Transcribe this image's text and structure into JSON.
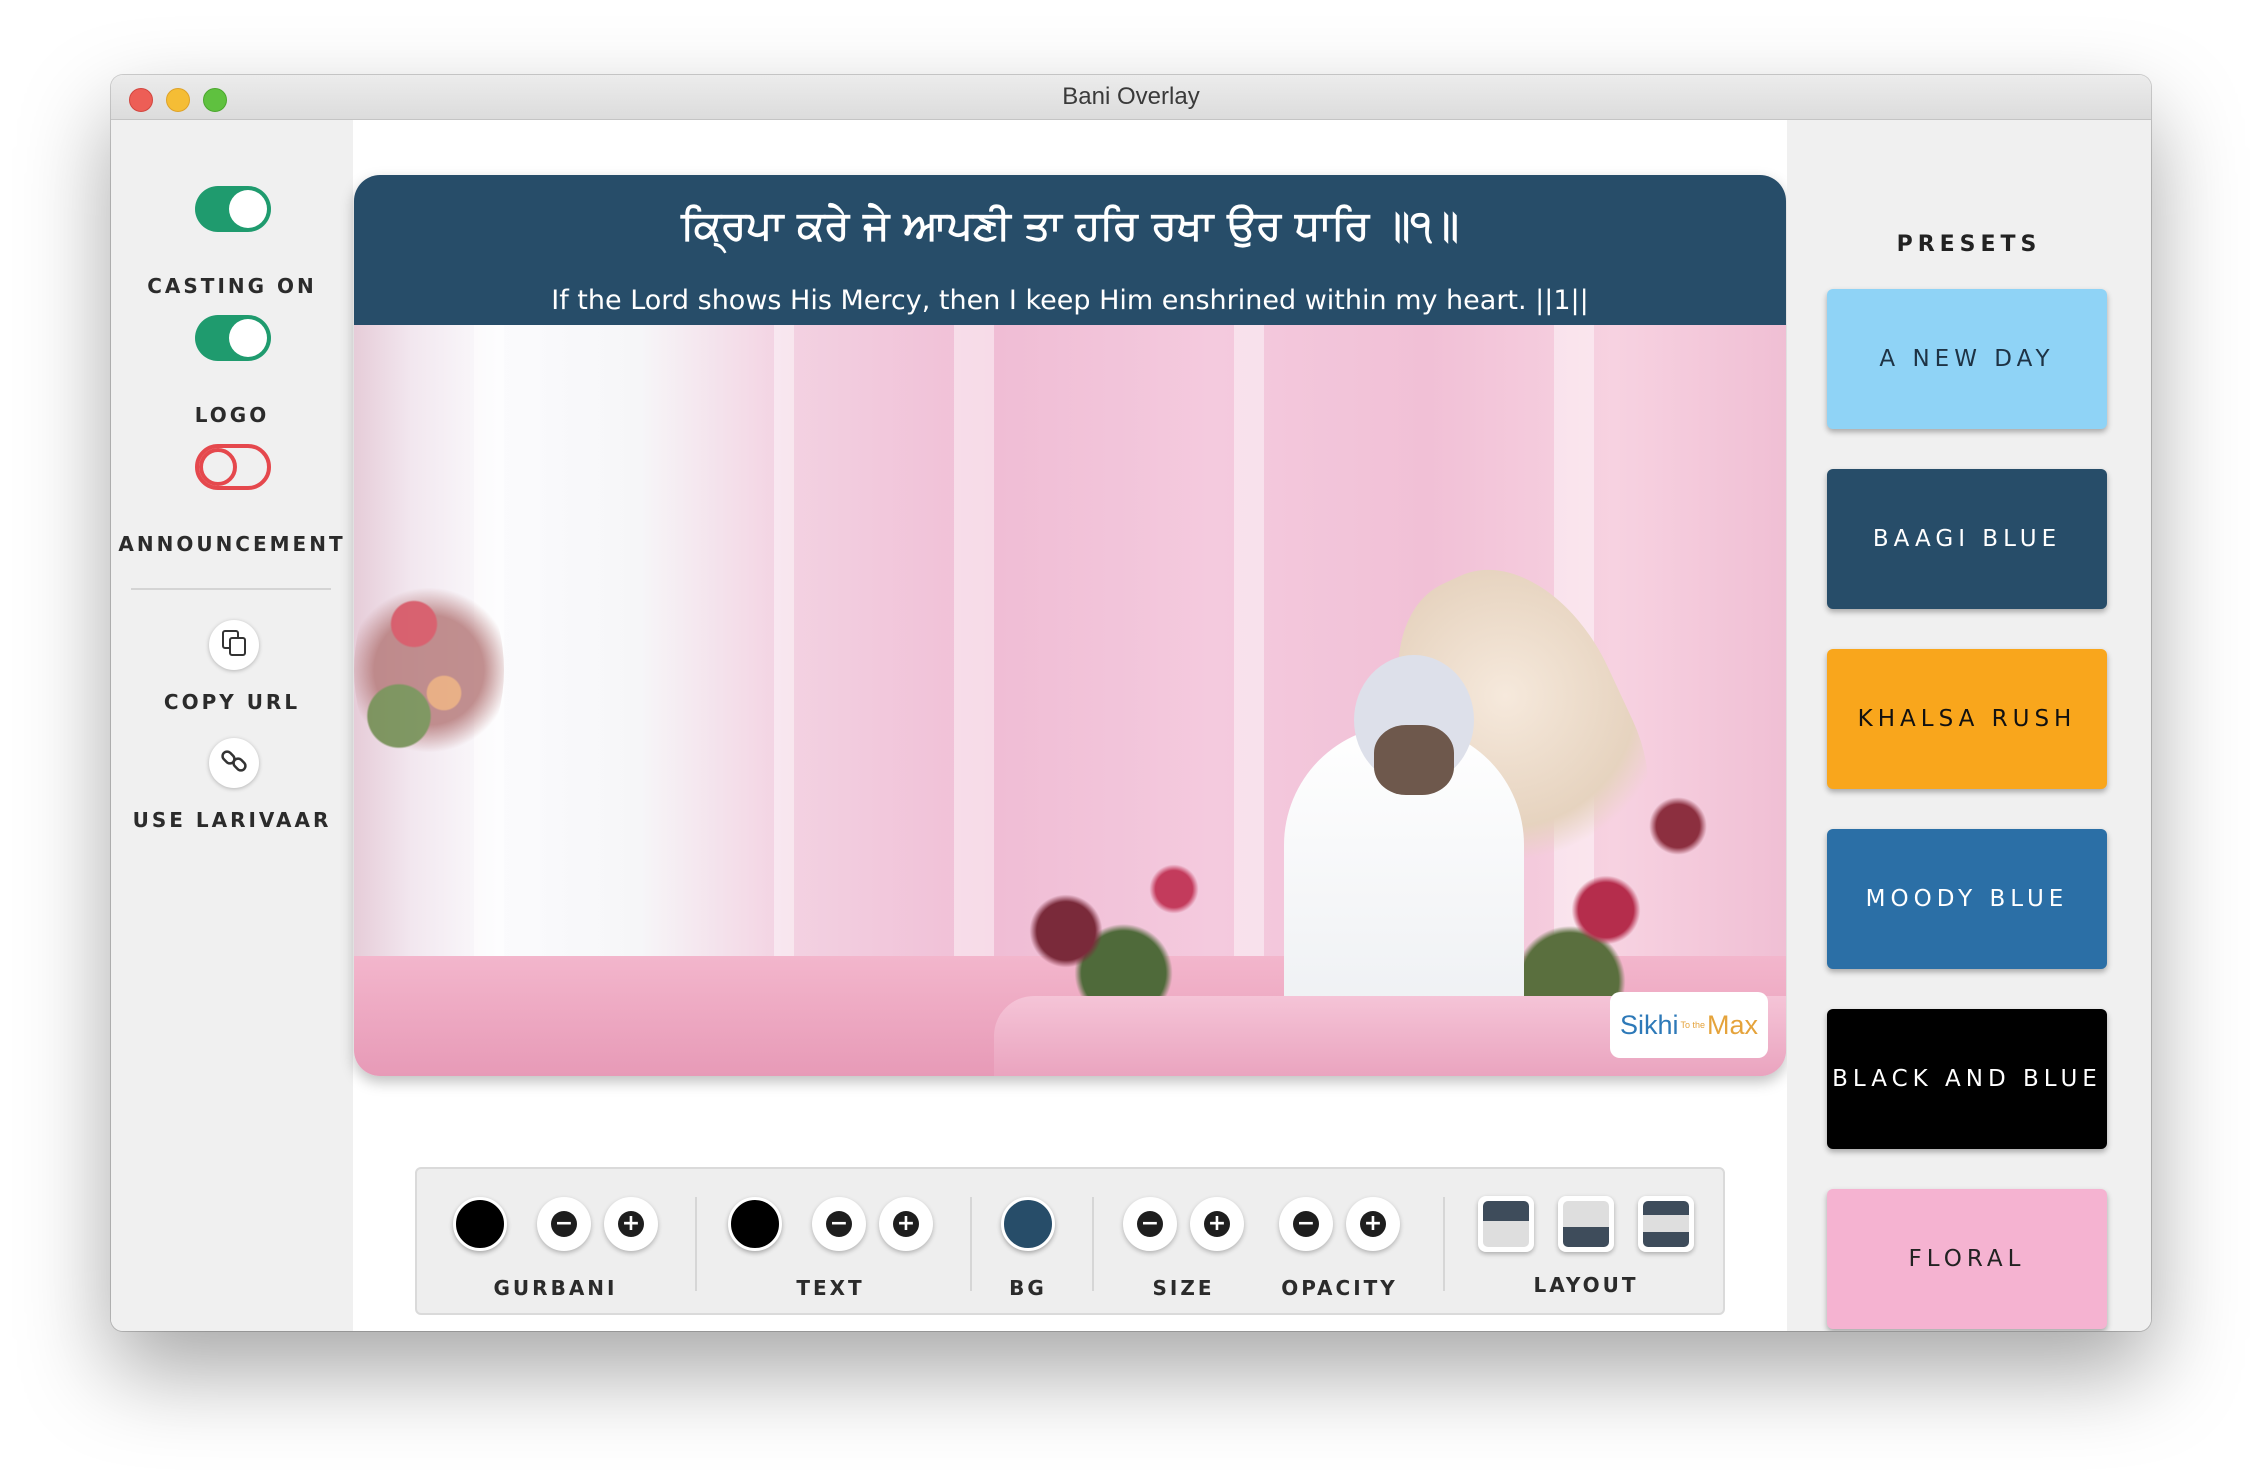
{
  "window": {
    "title": "Bani Overlay"
  },
  "left_panel": {
    "casting": {
      "label": "CASTING ON",
      "state": "on"
    },
    "logo": {
      "label": "LOGO",
      "state": "on"
    },
    "announcement": {
      "label": "ANNOUNCEMENT",
      "state": "off"
    },
    "copy_url": {
      "label": "COPY URL",
      "icon": "copy-icon"
    },
    "larivaar": {
      "label": "USE LARIVAAR",
      "icon": "link-icon"
    }
  },
  "preview": {
    "gurbani": "ਕ੍ਰਿਪਾ ਕਰੇ ਜੇ ਆਪਣੀ ਤਾ ਹਰਿ ਰਖਾ ਉਰ ਧਾਰਿ ॥੧॥",
    "translation": "If the Lord shows His Mercy, then I keep Him enshrined within my heart. ||1||",
    "banner_color": "#274d69",
    "logo": {
      "sikhi": "Sikhi",
      "small": "To the",
      "max": "Max"
    }
  },
  "toolbar": {
    "gurbani_label": "GURBANI",
    "text_label": "TEXT",
    "bg_label": "BG",
    "size_label": "SIZE",
    "opacity_label": "OPACITY",
    "layout_label": "LAYOUT",
    "minus_glyph": "−",
    "plus_glyph": "+",
    "gurbani_color": "#000000",
    "text_color": "#000000",
    "bg_color": "#274d69"
  },
  "presets": {
    "title": "PRESETS",
    "items": [
      {
        "label": "A NEW DAY",
        "bg": "#8fd3f6",
        "fg": "#1e3345"
      },
      {
        "label": "BAAGI BLUE",
        "bg": "#274d69",
        "fg": "#ffffff"
      },
      {
        "label": "KHALSA RUSH",
        "bg": "#f9a61c",
        "fg": "#111111"
      },
      {
        "label": "MOODY BLUE",
        "bg": "#2b6fa6",
        "fg": "#ffffff"
      },
      {
        "label": "BLACK AND BLUE",
        "bg": "#000000",
        "fg": "#ffffff"
      },
      {
        "label": "FLORAL",
        "bg": "#f5b3d1",
        "fg": "#222222"
      }
    ]
  }
}
